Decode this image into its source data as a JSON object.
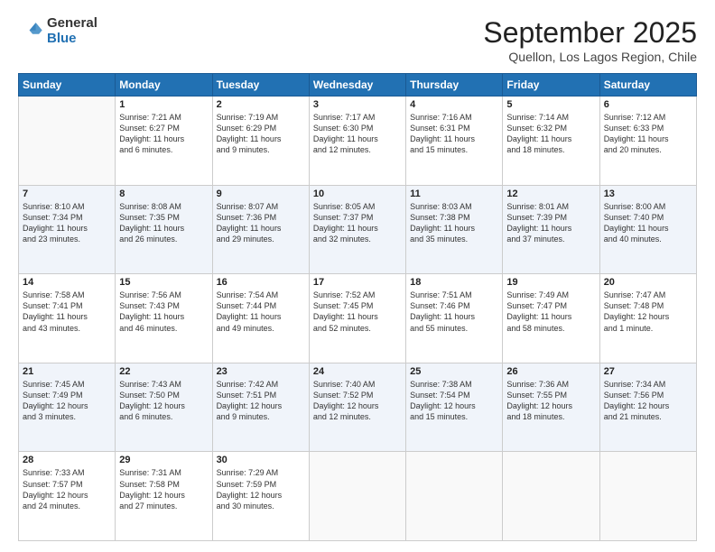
{
  "logo": {
    "general": "General",
    "blue": "Blue"
  },
  "header": {
    "month": "September 2025",
    "location": "Quellon, Los Lagos Region, Chile"
  },
  "weekdays": [
    "Sunday",
    "Monday",
    "Tuesday",
    "Wednesday",
    "Thursday",
    "Friday",
    "Saturday"
  ],
  "weeks": [
    [
      {
        "day": "",
        "content": ""
      },
      {
        "day": "1",
        "content": "Sunrise: 7:21 AM\nSunset: 6:27 PM\nDaylight: 11 hours\nand 6 minutes."
      },
      {
        "day": "2",
        "content": "Sunrise: 7:19 AM\nSunset: 6:29 PM\nDaylight: 11 hours\nand 9 minutes."
      },
      {
        "day": "3",
        "content": "Sunrise: 7:17 AM\nSunset: 6:30 PM\nDaylight: 11 hours\nand 12 minutes."
      },
      {
        "day": "4",
        "content": "Sunrise: 7:16 AM\nSunset: 6:31 PM\nDaylight: 11 hours\nand 15 minutes."
      },
      {
        "day": "5",
        "content": "Sunrise: 7:14 AM\nSunset: 6:32 PM\nDaylight: 11 hours\nand 18 minutes."
      },
      {
        "day": "6",
        "content": "Sunrise: 7:12 AM\nSunset: 6:33 PM\nDaylight: 11 hours\nand 20 minutes."
      }
    ],
    [
      {
        "day": "7",
        "content": "Sunrise: 8:10 AM\nSunset: 7:34 PM\nDaylight: 11 hours\nand 23 minutes."
      },
      {
        "day": "8",
        "content": "Sunrise: 8:08 AM\nSunset: 7:35 PM\nDaylight: 11 hours\nand 26 minutes."
      },
      {
        "day": "9",
        "content": "Sunrise: 8:07 AM\nSunset: 7:36 PM\nDaylight: 11 hours\nand 29 minutes."
      },
      {
        "day": "10",
        "content": "Sunrise: 8:05 AM\nSunset: 7:37 PM\nDaylight: 11 hours\nand 32 minutes."
      },
      {
        "day": "11",
        "content": "Sunrise: 8:03 AM\nSunset: 7:38 PM\nDaylight: 11 hours\nand 35 minutes."
      },
      {
        "day": "12",
        "content": "Sunrise: 8:01 AM\nSunset: 7:39 PM\nDaylight: 11 hours\nand 37 minutes."
      },
      {
        "day": "13",
        "content": "Sunrise: 8:00 AM\nSunset: 7:40 PM\nDaylight: 11 hours\nand 40 minutes."
      }
    ],
    [
      {
        "day": "14",
        "content": "Sunrise: 7:58 AM\nSunset: 7:41 PM\nDaylight: 11 hours\nand 43 minutes."
      },
      {
        "day": "15",
        "content": "Sunrise: 7:56 AM\nSunset: 7:43 PM\nDaylight: 11 hours\nand 46 minutes."
      },
      {
        "day": "16",
        "content": "Sunrise: 7:54 AM\nSunset: 7:44 PM\nDaylight: 11 hours\nand 49 minutes."
      },
      {
        "day": "17",
        "content": "Sunrise: 7:52 AM\nSunset: 7:45 PM\nDaylight: 11 hours\nand 52 minutes."
      },
      {
        "day": "18",
        "content": "Sunrise: 7:51 AM\nSunset: 7:46 PM\nDaylight: 11 hours\nand 55 minutes."
      },
      {
        "day": "19",
        "content": "Sunrise: 7:49 AM\nSunset: 7:47 PM\nDaylight: 11 hours\nand 58 minutes."
      },
      {
        "day": "20",
        "content": "Sunrise: 7:47 AM\nSunset: 7:48 PM\nDaylight: 12 hours\nand 1 minute."
      }
    ],
    [
      {
        "day": "21",
        "content": "Sunrise: 7:45 AM\nSunset: 7:49 PM\nDaylight: 12 hours\nand 3 minutes."
      },
      {
        "day": "22",
        "content": "Sunrise: 7:43 AM\nSunset: 7:50 PM\nDaylight: 12 hours\nand 6 minutes."
      },
      {
        "day": "23",
        "content": "Sunrise: 7:42 AM\nSunset: 7:51 PM\nDaylight: 12 hours\nand 9 minutes."
      },
      {
        "day": "24",
        "content": "Sunrise: 7:40 AM\nSunset: 7:52 PM\nDaylight: 12 hours\nand 12 minutes."
      },
      {
        "day": "25",
        "content": "Sunrise: 7:38 AM\nSunset: 7:54 PM\nDaylight: 12 hours\nand 15 minutes."
      },
      {
        "day": "26",
        "content": "Sunrise: 7:36 AM\nSunset: 7:55 PM\nDaylight: 12 hours\nand 18 minutes."
      },
      {
        "day": "27",
        "content": "Sunrise: 7:34 AM\nSunset: 7:56 PM\nDaylight: 12 hours\nand 21 minutes."
      }
    ],
    [
      {
        "day": "28",
        "content": "Sunrise: 7:33 AM\nSunset: 7:57 PM\nDaylight: 12 hours\nand 24 minutes."
      },
      {
        "day": "29",
        "content": "Sunrise: 7:31 AM\nSunset: 7:58 PM\nDaylight: 12 hours\nand 27 minutes."
      },
      {
        "day": "30",
        "content": "Sunrise: 7:29 AM\nSunset: 7:59 PM\nDaylight: 12 hours\nand 30 minutes."
      },
      {
        "day": "",
        "content": ""
      },
      {
        "day": "",
        "content": ""
      },
      {
        "day": "",
        "content": ""
      },
      {
        "day": "",
        "content": ""
      }
    ]
  ]
}
